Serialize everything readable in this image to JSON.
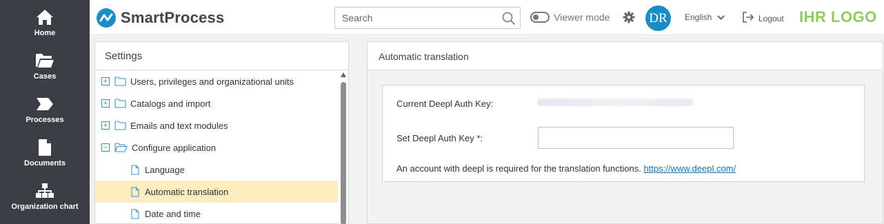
{
  "nav": {
    "items": [
      {
        "label": "Home",
        "icon": "home-icon"
      },
      {
        "label": "Cases",
        "icon": "folder-open-icon"
      },
      {
        "label": "Processes",
        "icon": "process-arrow-icon"
      },
      {
        "label": "Documents",
        "icon": "document-icon"
      },
      {
        "label": "Organization chart",
        "icon": "org-chart-icon"
      }
    ]
  },
  "header": {
    "app_name": "SmartProcess",
    "search_placeholder": "Search",
    "viewer_mode_label": "Viewer mode",
    "avatar_initials": "DR",
    "language": "English",
    "logout_label": "Logout",
    "brand_logo_text": "IHR LOGO"
  },
  "settings": {
    "title": "Settings",
    "tree": [
      {
        "label": "Users, privileges and organizational units",
        "expander": "+",
        "folder": "closed"
      },
      {
        "label": "Catalogs and import",
        "expander": "+",
        "folder": "closed"
      },
      {
        "label": "Emails and text modules",
        "expander": "+",
        "folder": "closed"
      },
      {
        "label": "Configure application",
        "expander": "−",
        "folder": "open"
      },
      {
        "label": "Language",
        "type": "document"
      },
      {
        "label": "Automatic translation",
        "type": "document",
        "selected": true
      },
      {
        "label": "Date and time",
        "type": "document"
      }
    ]
  },
  "detail": {
    "title": "Automatic translation",
    "current_key_label": "Current Deepl Auth Key:",
    "current_key_value": "",
    "set_key_label": "Set Deepl Auth Key *:",
    "set_key_value": "",
    "info_text": "An account with deepl is required for the translation functions.",
    "info_link": "https://www.deepl.com/"
  },
  "colors": {
    "nav_bg": "#3b3f45",
    "accent": "#1a8dc7",
    "selected_row": "#fbedc0",
    "brand_logo": "#8ecb5b",
    "link": "#1f6ea8"
  }
}
